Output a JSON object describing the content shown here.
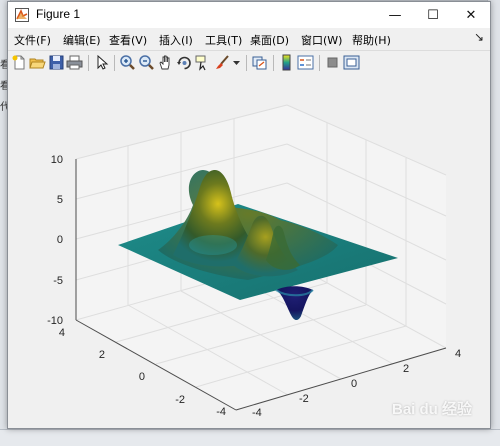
{
  "window": {
    "title": "Figure 1",
    "controls": {
      "minimize": "—",
      "maximize": "☐",
      "close": "✕"
    }
  },
  "menubar": {
    "items": [
      {
        "label": "文件(F)"
      },
      {
        "label": "编辑(E)"
      },
      {
        "label": "查看(V)"
      },
      {
        "label": "插入(I)"
      },
      {
        "label": "工具(T)"
      },
      {
        "label": "桌面(D)"
      },
      {
        "label": "窗口(W)"
      },
      {
        "label": "帮助(H)"
      }
    ],
    "dock_arrow": "↘"
  },
  "toolbar": {
    "icons": [
      "new-figure-icon",
      "open-file-icon",
      "save-icon",
      "print-icon",
      "edit-plot-icon",
      "zoom-in-icon",
      "zoom-out-icon",
      "pan-icon",
      "rotate-3d-icon",
      "data-cursor-icon",
      "brush-icon",
      "brush-dropdown-icon",
      "link-plot-icon",
      "insert-colorbar-icon",
      "insert-legend-icon",
      "hide-plot-tools-icon",
      "show-plot-tools-icon"
    ]
  },
  "axes": {
    "z_ticks": [
      "10",
      "5",
      "0",
      "-5",
      "-10"
    ],
    "y_ticks": [
      "4",
      "2",
      "0",
      "-2",
      "-4"
    ],
    "x_ticks": [
      "-2",
      "0",
      "2",
      "4"
    ],
    "x_first_tick": "-4"
  },
  "colors": {
    "window_bg": "#f0f0f0",
    "grid": "#dedede",
    "surface_low": "#1f8a8a",
    "surface_high": "#c9b21a",
    "surface_mid": "#1a6e5a",
    "surface_deep": "#1a1a6e"
  },
  "background": {
    "left_fragments": [
      "看",
      "看",
      "代"
    ],
    "watermark": "Bai du 经验"
  }
}
